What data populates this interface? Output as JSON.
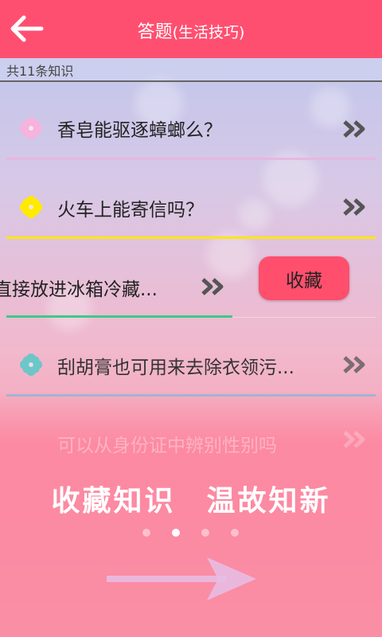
{
  "header": {
    "back_icon": "arrow-left-icon",
    "title_main": "答题",
    "title_sub": "(生活技巧)"
  },
  "count_text": "共11条知识",
  "questions": [
    {
      "text": "香皂能驱逐蟑螂么？",
      "flower_color": "#f6b3dc",
      "line_color": "#e7b7e0"
    },
    {
      "text": "火车上能寄信吗？",
      "flower_color": "#ffea00",
      "line_color": "#ffe600"
    },
    {
      "text": "直接放进冰箱冷藏...",
      "flower_color": "",
      "line_color": "#3ec98a"
    },
    {
      "text": "刮胡膏也可用来去除衣领污...",
      "flower_color": "#6dc6c8",
      "line_color": "#9ab8d6"
    }
  ],
  "favorite_button": "收藏",
  "faded_question": "可以从身份证中辨别性别吗",
  "promo_text": "收藏知识　温故知新",
  "pager": {
    "count": 4,
    "active_index": 1
  },
  "colors": {
    "header": "#ff4f70",
    "favorite": "#ff4f6d"
  }
}
